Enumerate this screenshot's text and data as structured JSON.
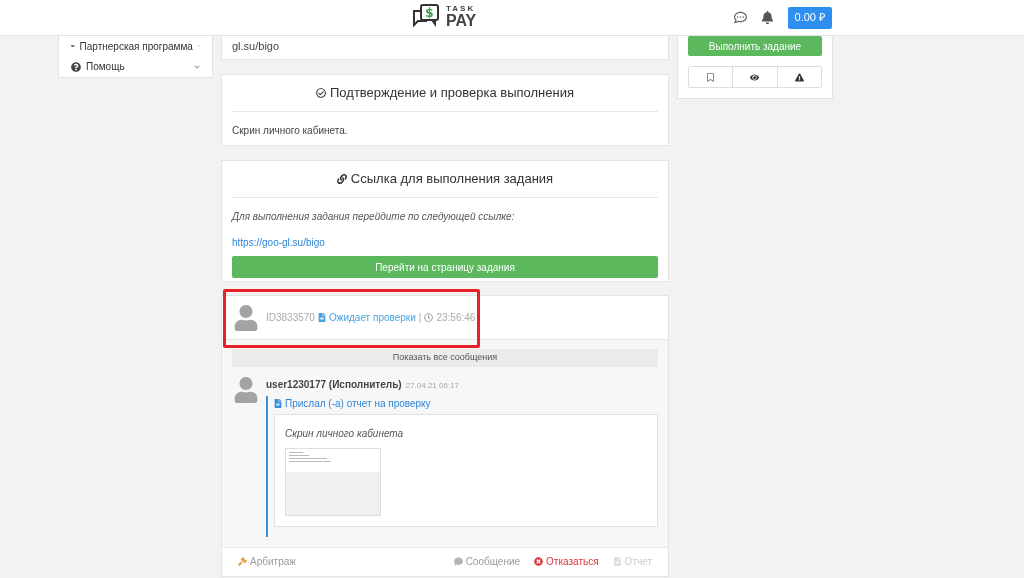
{
  "header": {
    "logo_symbol": "$",
    "logo_top": "TASK",
    "logo_bottom": "PAY",
    "balance": "0.00 ₽"
  },
  "sidebar": {
    "items": [
      {
        "label": "Партнерская программа",
        "kind": "partner",
        "expanded": false
      },
      {
        "label": "Помощь",
        "kind": "help",
        "expanded": false
      }
    ]
  },
  "task_link_tail": "gl.su/bigo",
  "confirmation": {
    "title": "Подтверждение и проверка выполнения",
    "text": "Скрин личного кабинета."
  },
  "link_section": {
    "title": "Ссылка для выполнения задания",
    "hint": "Для выполнения задания перейдите по следующей ссылке:",
    "url": "https://goo-gl.su/bigo",
    "button": "Перейти на страницу задания"
  },
  "report": {
    "id": "ID3833570",
    "status": "Ожидает проверки",
    "separator": "|",
    "timer": "23:56:46",
    "highlighted": true,
    "show_all": "Показать все сообщения",
    "messages": [
      {
        "author": "user1230177 (Исполнитель)",
        "date": "27.04.21 06:17",
        "action": "Прислал (-а) отчет на проверку",
        "report_title": "Скрин личного кабинета"
      }
    ],
    "actions": [
      {
        "kind": "arbitration",
        "label": "Арбитраж",
        "disabled": false
      },
      {
        "kind": "message",
        "label": "Сообщение",
        "disabled": false
      },
      {
        "kind": "refuse",
        "label": "Отказаться",
        "disabled": false
      },
      {
        "kind": "report",
        "label": "Отчет",
        "disabled": true
      }
    ]
  },
  "right_panel": {
    "button": "Выполнить задание",
    "tools": [
      {
        "kind": "bookmark"
      },
      {
        "kind": "view"
      },
      {
        "kind": "warning"
      }
    ]
  }
}
